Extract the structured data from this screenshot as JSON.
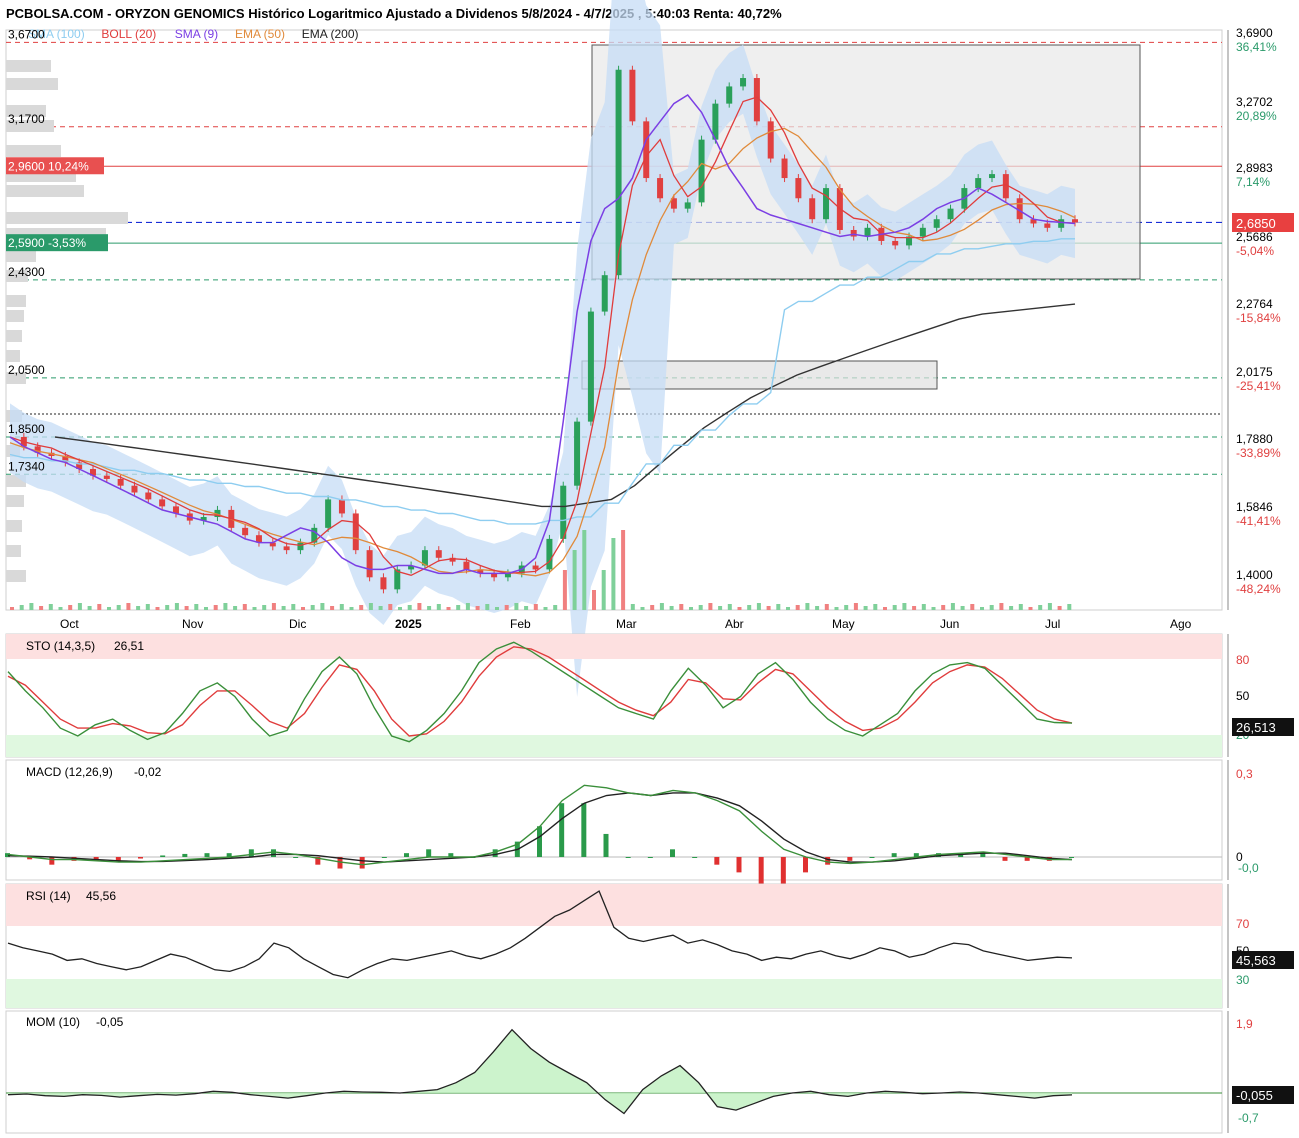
{
  "title": "PCBOLSA.COM - ORYZON GENOMICS Histórico Logaritmico Ajustado a Dividenos 5/8/2024 - 4/7/2025 , 5:40:03 Renta: 40,72%",
  "colors": {
    "sma100": "#8ecdf0",
    "boll": "#e03c3c",
    "sma9": "#7b3fe4",
    "ema50": "#e08a3a",
    "ema200": "#333333",
    "up": "#2aa05a",
    "down": "#e04040",
    "bollBand": "#c5dcf5",
    "resistance": "#e04040",
    "support": "#2a9a6a",
    "current": "#1a2fd6"
  },
  "legend": [
    {
      "label": "SMA (100)",
      "color": "#8ecdf0"
    },
    {
      "label": "BOLL (20)",
      "color": "#e03c3c"
    },
    {
      "label": "SMA (9)",
      "color": "#7b3fe4"
    },
    {
      "label": "EMA (50)",
      "color": "#e08a3a"
    },
    {
      "label": "EMA (200)",
      "color": "#222222"
    }
  ],
  "chart_data": [
    {
      "type": "line",
      "name": "price",
      "scale": "log",
      "ylim": [
        1.37,
        3.75
      ],
      "x_ticks": [
        "Oct",
        "Nov",
        "Dic",
        "2025",
        "Feb",
        "Mar",
        "Abr",
        "May",
        "Jun",
        "Jul",
        "Ago"
      ],
      "right_ticks": [
        {
          "price": "3,6900",
          "pct": "36,41%"
        },
        {
          "price": "3,2702",
          "pct": "20,89%"
        },
        {
          "price": "2,8983",
          "pct": "7,14%"
        },
        {
          "price": "2,5686",
          "pct": "-5,04%"
        },
        {
          "price": "2,2764",
          "pct": "-15,84%"
        },
        {
          "price": "2,0175",
          "pct": "-25,41%"
        },
        {
          "price": "1,7880",
          "pct": "-33,89%"
        },
        {
          "price": "1,5846",
          "pct": "-41,41%"
        },
        {
          "price": "1,4000",
          "pct": "-48,24%"
        }
      ],
      "levels": [
        {
          "label": "3,6700",
          "value": 3.67
        },
        {
          "label": "3,1700",
          "value": 3.17
        },
        {
          "label": "2,9600  10,24%",
          "value": 2.96
        },
        {
          "label": "2,5900  -3,53%",
          "value": 2.59
        },
        {
          "label": "2,4300",
          "value": 2.43
        },
        {
          "label": "2,0500",
          "value": 2.05
        },
        {
          "label": "1,8500",
          "value": 1.85
        },
        {
          "label": "1,7340",
          "value": 1.734
        }
      ],
      "current": {
        "label": "2,6850",
        "value": 2.685
      },
      "close": [
        1.85,
        1.82,
        1.8,
        1.79,
        1.77,
        1.75,
        1.73,
        1.72,
        1.7,
        1.68,
        1.66,
        1.64,
        1.62,
        1.6,
        1.61,
        1.63,
        1.58,
        1.56,
        1.54,
        1.53,
        1.52,
        1.54,
        1.58,
        1.66,
        1.62,
        1.52,
        1.45,
        1.42,
        1.47,
        1.48,
        1.52,
        1.5,
        1.49,
        1.47,
        1.46,
        1.45,
        1.46,
        1.48,
        1.47,
        1.55,
        1.7,
        1.9,
        2.3,
        2.45,
        3.5,
        3.2,
        2.9,
        2.8,
        2.75,
        2.78,
        3.1,
        3.3,
        3.4,
        3.45,
        3.2,
        3.0,
        2.9,
        2.8,
        2.7,
        2.85,
        2.65,
        2.62,
        2.66,
        2.6,
        2.58,
        2.62,
        2.66,
        2.7,
        2.75,
        2.85,
        2.9,
        2.92,
        2.8,
        2.7,
        2.68,
        2.66,
        2.7,
        2.685
      ],
      "sma9": [
        1.85,
        1.82,
        1.8,
        1.78,
        1.77,
        1.75,
        1.73,
        1.71,
        1.69,
        1.67,
        1.65,
        1.63,
        1.62,
        1.61,
        1.6,
        1.59,
        1.57,
        1.55,
        1.54,
        1.54,
        1.56,
        1.58,
        1.57,
        1.54,
        1.5,
        1.48,
        1.47,
        1.47,
        1.48,
        1.48,
        1.47,
        1.46,
        1.46,
        1.47,
        1.46,
        1.46,
        1.46,
        1.47,
        1.5,
        1.6,
        1.9,
        2.3,
        2.6,
        2.75,
        2.8,
        2.9,
        3.1,
        3.2,
        3.3,
        3.35,
        3.25,
        3.1,
        2.95,
        2.85,
        2.75,
        2.72,
        2.7,
        2.68,
        2.66,
        2.64,
        2.62,
        2.63,
        2.62,
        2.63,
        2.64,
        2.66,
        2.7,
        2.75,
        2.78,
        2.8,
        2.85,
        2.82,
        2.78,
        2.74,
        2.7,
        2.69,
        2.685,
        2.68
      ],
      "ema200": [
        1.85,
        1.84,
        1.83,
        1.82,
        1.81,
        1.8,
        1.79,
        1.78,
        1.77,
        1.76,
        1.75,
        1.74,
        1.73,
        1.72,
        1.71,
        1.7,
        1.69,
        1.68,
        1.67,
        1.66,
        1.65,
        1.64,
        1.64,
        1.65,
        1.66,
        1.7,
        1.76,
        1.82,
        1.88,
        1.93,
        1.98,
        2.02,
        2.06,
        2.09,
        2.12,
        2.15,
        2.18,
        2.21,
        2.24,
        2.27,
        2.29,
        2.3,
        2.31,
        2.32,
        2.33
      ]
    },
    {
      "type": "line",
      "name": "STO",
      "title": "STO (14,3,5)",
      "value_label": "26,51",
      "ylim": [
        0,
        100
      ],
      "ticks": [
        "80",
        "50",
        "20"
      ],
      "current_badge": "26,513",
      "k": [
        72,
        55,
        40,
        22,
        15,
        25,
        30,
        20,
        12,
        18,
        35,
        55,
        62,
        50,
        30,
        15,
        20,
        48,
        72,
        85,
        70,
        40,
        15,
        10,
        20,
        35,
        55,
        80,
        92,
        98,
        90,
        80,
        70,
        60,
        50,
        40,
        35,
        30,
        55,
        75,
        60,
        40,
        50,
        70,
        80,
        65,
        45,
        30,
        20,
        15,
        25,
        35,
        55,
        70,
        78,
        80,
        75,
        60,
        45,
        30,
        27,
        26.5
      ],
      "d": [
        68,
        60,
        45,
        30,
        22,
        22,
        26,
        24,
        18,
        17,
        25,
        42,
        55,
        55,
        42,
        28,
        22,
        35,
        58,
        78,
        74,
        55,
        30,
        15,
        17,
        28,
        45,
        68,
        85,
        94,
        92,
        85,
        75,
        65,
        55,
        45,
        38,
        33,
        45,
        65,
        62,
        48,
        47,
        62,
        74,
        70,
        55,
        40,
        28,
        20,
        22,
        30,
        45,
        62,
        72,
        78,
        76,
        66,
        52,
        38,
        30,
        26.5
      ]
    },
    {
      "type": "line",
      "name": "MACD",
      "title": "MACD (12,26,9)",
      "value_label": "-0,02",
      "ylim": [
        -0.05,
        0.32
      ],
      "ticks": [
        "0,3",
        "0",
        "-0,0"
      ],
      "macd": [
        0.01,
        0.0,
        -0.01,
        -0.01,
        -0.015,
        -0.02,
        -0.02,
        -0.015,
        -0.01,
        -0.005,
        0.0,
        0.01,
        0.02,
        0.01,
        -0.005,
        -0.02,
        -0.03,
        -0.02,
        -0.01,
        0.0,
        0.0,
        0.0,
        0.02,
        0.05,
        0.12,
        0.22,
        0.28,
        0.27,
        0.25,
        0.24,
        0.26,
        0.25,
        0.22,
        0.18,
        0.1,
        0.03,
        0.0,
        -0.02,
        -0.025,
        -0.02,
        -0.01,
        0.0,
        0.01,
        0.015,
        0.02,
        0.01,
        0.0,
        -0.01,
        -0.01
      ],
      "signal": [
        0.005,
        0.003,
        0.0,
        -0.005,
        -0.01,
        -0.015,
        -0.018,
        -0.017,
        -0.014,
        -0.01,
        -0.005,
        0.0,
        0.01,
        0.01,
        0.005,
        -0.005,
        -0.015,
        -0.02,
        -0.015,
        -0.01,
        -0.005,
        0.0,
        0.01,
        0.03,
        0.08,
        0.15,
        0.21,
        0.24,
        0.25,
        0.24,
        0.25,
        0.25,
        0.23,
        0.2,
        0.14,
        0.07,
        0.02,
        -0.01,
        -0.02,
        -0.02,
        -0.015,
        -0.005,
        0.005,
        0.01,
        0.015,
        0.015,
        0.005,
        -0.005,
        -0.01
      ]
    },
    {
      "type": "line",
      "name": "RSI",
      "title": "RSI (14)",
      "value_label": "45,56",
      "ylim": [
        15,
        90
      ],
      "ticks": [
        "70",
        "50",
        "30"
      ],
      "current_badge": "45,563",
      "values": [
        55,
        52,
        50,
        48,
        44,
        45,
        42,
        40,
        38,
        40,
        44,
        48,
        46,
        42,
        38,
        37,
        40,
        45,
        55,
        52,
        45,
        40,
        35,
        33,
        38,
        42,
        45,
        44,
        46,
        48,
        50,
        47,
        45,
        48,
        52,
        58,
        65,
        72,
        76,
        82,
        88,
        65,
        58,
        56,
        58,
        60,
        55,
        57,
        54,
        50,
        48,
        44,
        46,
        45,
        48,
        50,
        47,
        45,
        48,
        52,
        50,
        46,
        48,
        52,
        55,
        54,
        50,
        48,
        46,
        44,
        45,
        46,
        45.56
      ]
    },
    {
      "type": "area",
      "name": "MOM",
      "title": "MOM (10)",
      "value_label": "-0,05",
      "ylim": [
        -0.8,
        2.0
      ],
      "ticks": [
        "1,9",
        "-0,055",
        "-0,7"
      ],
      "current_badge": "-0,055",
      "values": [
        -0.05,
        -0.03,
        -0.08,
        -0.1,
        -0.05,
        -0.07,
        -0.12,
        -0.08,
        -0.04,
        -0.06,
        -0.02,
        0.05,
        0.02,
        -0.05,
        -0.1,
        -0.15,
        -0.08,
        0.0,
        0.05,
        0.03,
        0.02,
        0.0,
        0.05,
        0.1,
        0.3,
        0.6,
        1.2,
        1.85,
        1.3,
        0.9,
        0.6,
        0.3,
        -0.2,
        -0.6,
        0.1,
        0.5,
        0.8,
        0.3,
        -0.4,
        -0.5,
        -0.3,
        -0.1,
        0.0,
        0.05,
        -0.05,
        -0.1,
        0.0,
        0.05,
        0.02,
        -0.02,
        0.0,
        0.03,
        0.0,
        -0.05,
        -0.1,
        -0.15,
        -0.08,
        -0.055
      ]
    }
  ]
}
